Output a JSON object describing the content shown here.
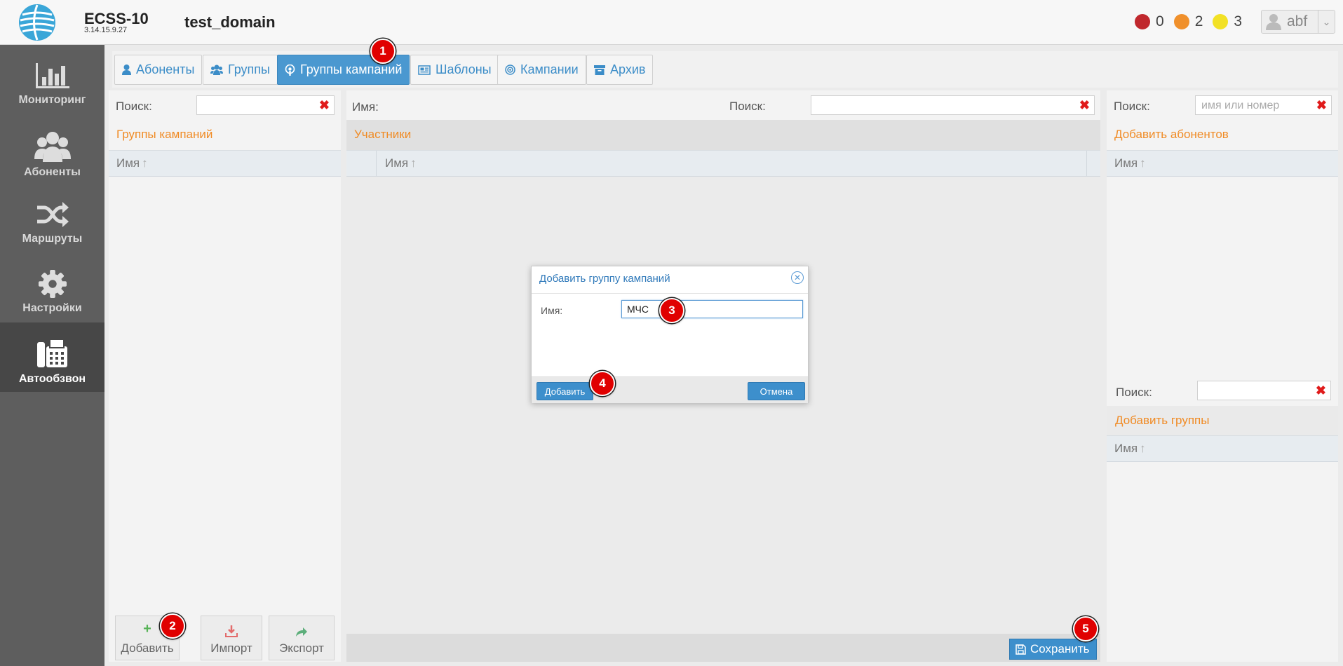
{
  "header": {
    "app_title": "ECSS-10",
    "version": "3.14.15.9.27",
    "domain": "test_domain",
    "alarms": [
      {
        "color": "#c0282d",
        "count": "0"
      },
      {
        "color": "#f0902b",
        "count": "2"
      },
      {
        "color": "#f2e125",
        "count": "3"
      }
    ],
    "user": "abf"
  },
  "sidebar": {
    "items": [
      {
        "label": "Мониторинг",
        "icon": "bar-chart-icon"
      },
      {
        "label": "Абоненты",
        "icon": "users-icon"
      },
      {
        "label": "Маршруты",
        "icon": "shuffle-icon"
      },
      {
        "label": "Настройки",
        "icon": "gear-icon"
      },
      {
        "label": "Автообзвон",
        "icon": "fax-phone-icon"
      }
    ]
  },
  "tabs": [
    {
      "label": "Абоненты",
      "icon": "user-icon"
    },
    {
      "label": "Группы",
      "icon": "users-icon"
    },
    {
      "label": "Группы кампаний",
      "icon": "podcast-icon"
    },
    {
      "label": "Шаблоны",
      "icon": "newspaper-icon"
    },
    {
      "label": "Кампании",
      "icon": "target-icon"
    },
    {
      "label": "Архив",
      "icon": "archive-icon"
    }
  ],
  "left": {
    "search_label": "Поиск:",
    "section_title": "Группы кампаний",
    "col_name": "Имя",
    "buttons": {
      "add": "Добавить",
      "import": "Импорт",
      "export": "Экспорт"
    }
  },
  "middle": {
    "name_label": "Имя:",
    "search_label": "Поиск:",
    "section_title": "Участники",
    "col_name": "Имя",
    "save": "Сохранить"
  },
  "right": {
    "search_label": "Поиск:",
    "search_placeholder": "имя или номер",
    "add_subscribers": "Добавить абонентов",
    "col_name": "Имя",
    "search_label2": "Поиск:",
    "add_groups": "Добавить группы",
    "col_name2": "Имя"
  },
  "dialog": {
    "title": "Добавить группу кампаний",
    "name_label": "Имя:",
    "name_value": "МЧС",
    "add": "Добавить",
    "cancel": "Отмена"
  },
  "markers": [
    "1",
    "2",
    "3",
    "4",
    "5"
  ]
}
